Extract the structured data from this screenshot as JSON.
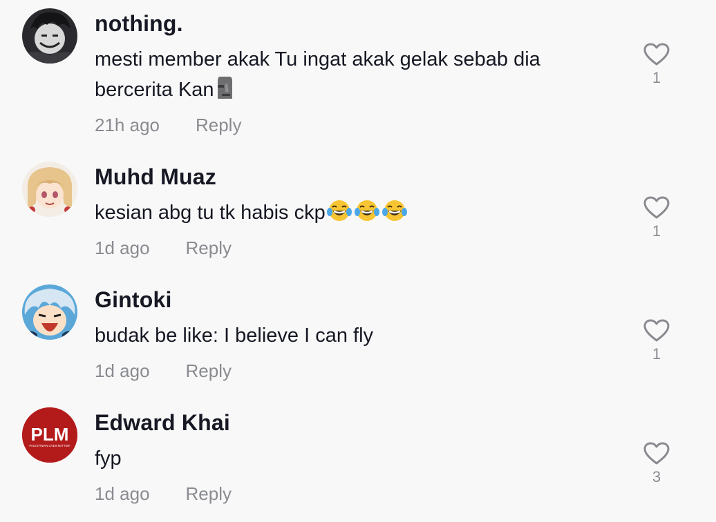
{
  "comments": [
    {
      "username": "nothing.",
      "text": "mesti member akak Tu ingat akak gelak sebab dia bercerita Kan",
      "emoji": "moai-emoji",
      "time": "21h ago",
      "reply_label": "Reply",
      "likes": "1"
    },
    {
      "username": "Muhd Muaz",
      "text": "kesian abg tu tk habis ckp",
      "emoji": "laughing-tears-emoji x3",
      "time": "1d ago",
      "reply_label": "Reply",
      "likes": "1"
    },
    {
      "username": "Gintoki",
      "text": "budak be like: I believe I can fly",
      "time": "1d ago",
      "reply_label": "Reply",
      "likes": "1"
    },
    {
      "username": "Edward Khai",
      "text": "fyp",
      "avatar_text": "PLM",
      "avatar_subtext": "PALESTINIAN LIVES MATTER!",
      "time": "1d ago",
      "reply_label": "Reply",
      "likes": "3"
    }
  ],
  "colors": {
    "background": "#f8f8f8",
    "text": "#161823",
    "muted": "#8a8b91",
    "plm_red": "#b31b1b"
  },
  "icons": [
    "heart-outline-icon"
  ]
}
